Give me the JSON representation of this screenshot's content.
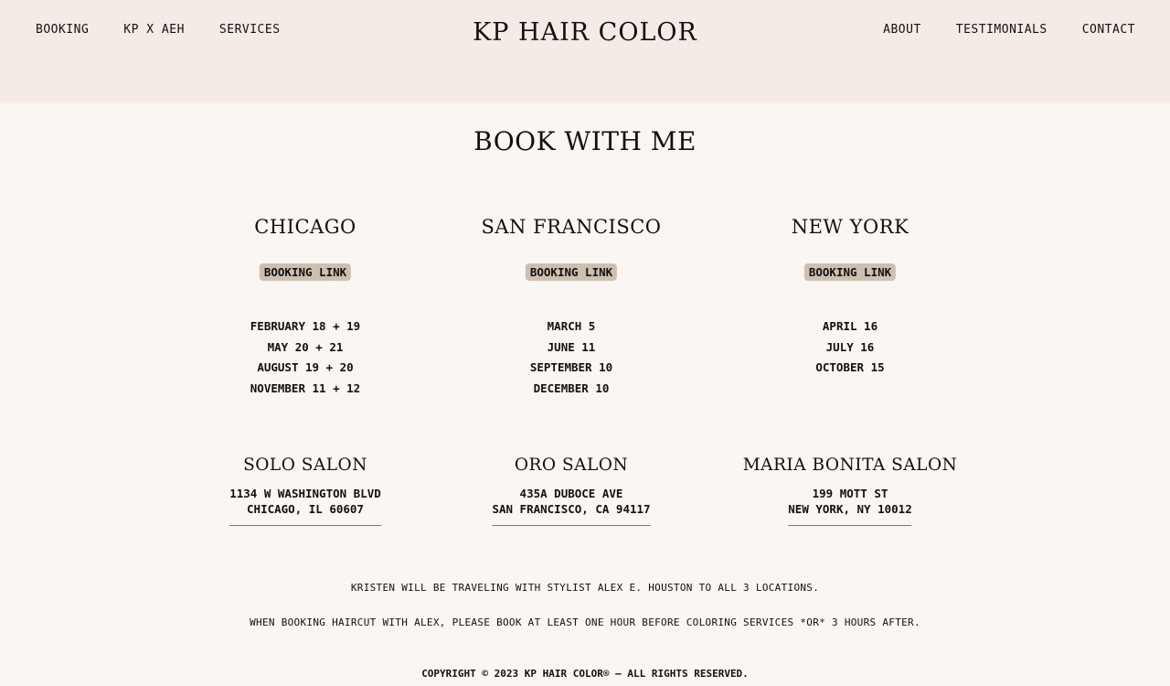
{
  "header": {
    "logo": "KP HAIR COLOR",
    "nav_left": [
      "BOOKING",
      "KP X AEH",
      "SERVICES"
    ],
    "nav_right": [
      "ABOUT",
      "TESTIMONIALS",
      "CONTACT"
    ]
  },
  "main": {
    "title": "BOOK WITH ME",
    "locations": [
      {
        "city": "CHICAGO",
        "booking_label": "BOOKING LINK",
        "dates": [
          "FEBRUARY 18 + 19",
          "MAY 20 + 21",
          "AUGUST 19 + 20",
          "NOVEMBER 11 + 12"
        ],
        "salon": "SOLO SALON",
        "address_line1": "1134 W WASHINGTON BLVD",
        "address_line2": "CHICAGO, IL 60607"
      },
      {
        "city": "SAN FRANCISCO",
        "booking_label": "BOOKING LINK",
        "dates": [
          "MARCH 5",
          "JUNE 11",
          "SEPTEMBER 10",
          "DECEMBER 10"
        ],
        "salon": "ORO SALON",
        "address_line1": "435A DUBOCE AVE",
        "address_line2": "SAN FRANCISCO, CA 94117"
      },
      {
        "city": "NEW YORK",
        "booking_label": "BOOKING LINK",
        "dates": [
          "APRIL 16",
          "JULY 16",
          "OCTOBER 15"
        ],
        "salon": "MARIA BONITA SALON",
        "address_line1": "199 MOTT ST",
        "address_line2": "NEW YORK, NY 10012"
      }
    ],
    "notes": [
      "KRISTEN WILL BE TRAVELING WITH STYLIST ALEX E. HOUSTON TO ALL 3 LOCATIONS.",
      "WHEN BOOKING HAIRCUT WITH ALEX, PLEASE BOOK AT LEAST ONE HOUR BEFORE COLORING SERVICES *OR* 3 HOURS AFTER."
    ]
  },
  "footer": {
    "copyright": "COPYRIGHT © 2023 KP HAIR COLOR® — ALL RIGHTS RESERVED."
  },
  "colors": {
    "header_bg": "#f5ebe6",
    "page_bg": "#faf6f2",
    "button_bg": "#cdc0b1"
  }
}
